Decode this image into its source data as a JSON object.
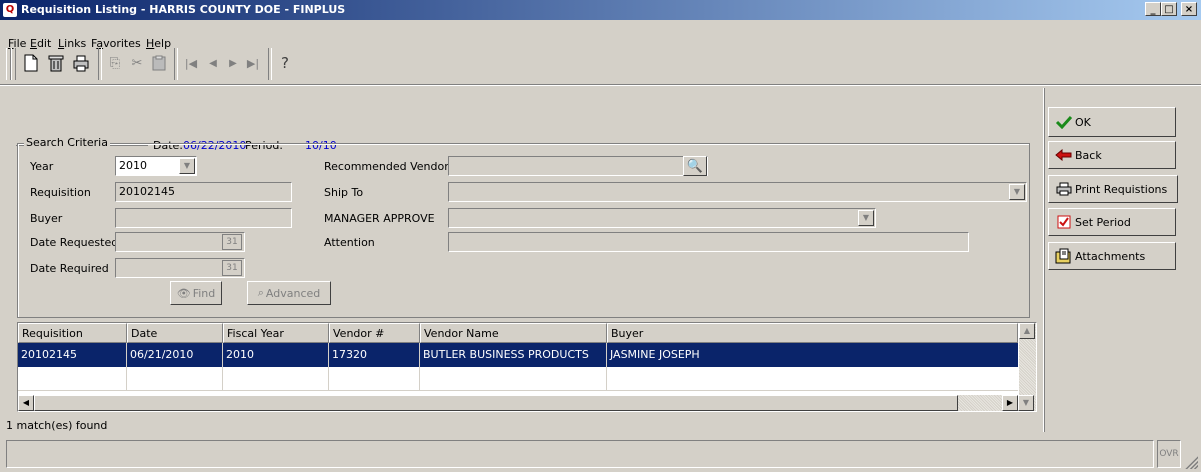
{
  "window": {
    "title": "Requisition Listing - HARRIS COUNTY DOE - FINPLUS",
    "app_icon": "finplus-q-icon",
    "controls": [
      "minimize",
      "maximize",
      "close"
    ]
  },
  "menu": [
    {
      "label": "File",
      "accel": "F",
      "rest": "ile"
    },
    {
      "label": "Edit",
      "accel": "E",
      "rest": "dit"
    },
    {
      "label": "Links",
      "accel": "L",
      "rest": "inks"
    },
    {
      "label": "Favorites",
      "accel": "a",
      "pre": "F",
      "rest": "vorites"
    },
    {
      "label": "Help",
      "accel": "H",
      "rest": "elp"
    }
  ],
  "toolbar": {
    "icons": [
      "new-document-icon",
      "delete-trash-icon",
      "print-icon",
      "copy-icon",
      "cut-icon",
      "paste-icon",
      "first-record-icon",
      "previous-record-icon",
      "next-record-icon",
      "last-record-icon",
      "help-icon"
    ]
  },
  "header": {
    "date_label": "Date:",
    "date_value": "06/22/2010",
    "period_label": "Period:",
    "period_value": "10/10"
  },
  "search": {
    "group_title": "Search Criteria",
    "year_label": "Year",
    "year_value": "2010",
    "requisition_label": "Requisition",
    "requisition_value": "20102145",
    "buyer_label": "Buyer",
    "buyer_value": "",
    "date_requested_label": "Date Requested",
    "date_requested_value": "",
    "date_required_label": "Date Required",
    "date_required_value": "",
    "recommended_vendor_label": "Recommended Vendor",
    "recommended_vendor_value": "",
    "ship_to_label": "Ship To",
    "ship_to_value": "",
    "manager_approve_label": "MANAGER APPROVE",
    "manager_approve_value": "",
    "attention_label": "Attention",
    "attention_value": "",
    "find_label": "Find",
    "advanced_label": "Advanced"
  },
  "grid": {
    "columns": [
      "Requisition",
      "Date",
      "Fiscal Year",
      "Vendor #",
      "Vendor Name",
      "Buyer"
    ],
    "rows": [
      [
        "20102145",
        "06/21/2010",
        "2010",
        "17320",
        "BUTLER BUSINESS PRODUCTS",
        "JASMINE JOSEPH"
      ]
    ]
  },
  "status": {
    "matches": "1 match(es) found",
    "ovr": "OVR"
  },
  "side_buttons": {
    "ok": "OK",
    "back": "Back",
    "print": "Print Requistions",
    "set_period": "Set Period",
    "attachments": "Attachments"
  },
  "colors": {
    "title_start": "#0a246a",
    "title_end": "#a6caf0",
    "selection": "#0a246a",
    "face": "#d4d0c8",
    "value_blue": "#0000cc"
  }
}
